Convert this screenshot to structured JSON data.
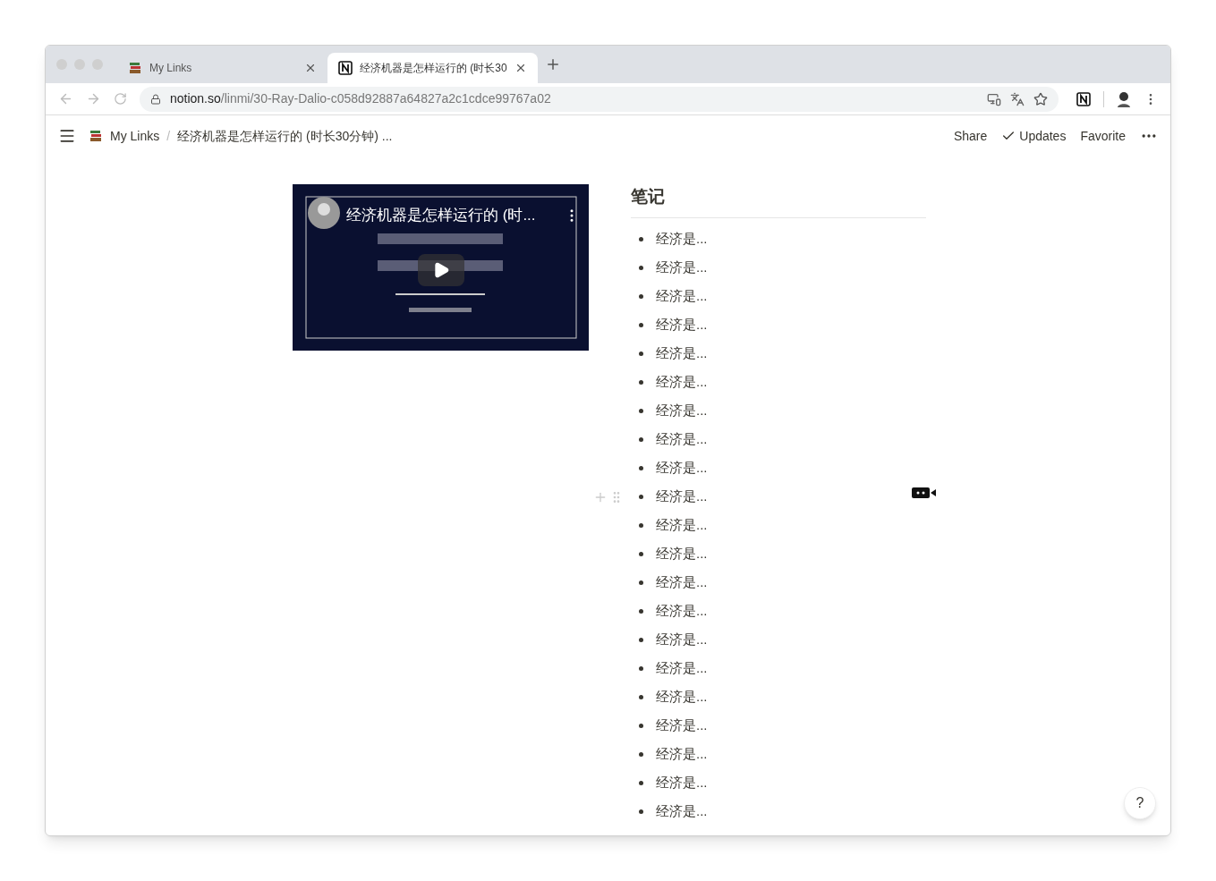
{
  "browser": {
    "tabs": [
      {
        "title": "My Links",
        "selected": false
      },
      {
        "title": "经济机器是怎样运行的 (时长30",
        "selected": true
      }
    ],
    "url": {
      "host": "notion.so",
      "path": "/linmi/30-Ray-Dalio-c058d92887a64827a2c1cdce99767a02"
    }
  },
  "topbar": {
    "separator": "/",
    "breadcrumbs": [
      "My Links",
      "经济机器是怎样运行的 (时长30分钟) ..."
    ],
    "actions": [
      "Share",
      "Updates",
      "Favorite"
    ]
  },
  "video": {
    "title": "经济机器是怎样运行的 (时..."
  },
  "notes": {
    "heading": "笔记",
    "items": [
      {
        "text": "经济是...",
        "hovered": false
      },
      {
        "text": "经济是...",
        "hovered": false
      },
      {
        "text": "经济是...",
        "hovered": false
      },
      {
        "text": "经济是...",
        "hovered": false
      },
      {
        "text": "经济是...",
        "hovered": false
      },
      {
        "text": "经济是...",
        "hovered": false
      },
      {
        "text": "经济是...",
        "hovered": false
      },
      {
        "text": "经济是...",
        "hovered": false
      },
      {
        "text": "经济是...",
        "hovered": false
      },
      {
        "text": "经济是...",
        "hovered": true
      },
      {
        "text": "经济是...",
        "hovered": false
      },
      {
        "text": "经济是...",
        "hovered": false
      },
      {
        "text": "经济是...",
        "hovered": false
      },
      {
        "text": "经济是...",
        "hovered": false
      },
      {
        "text": "经济是...",
        "hovered": false
      },
      {
        "text": "经济是...",
        "hovered": false
      },
      {
        "text": "经济是...",
        "hovered": false
      },
      {
        "text": "经济是...",
        "hovered": false
      },
      {
        "text": "经济是...",
        "hovered": false
      },
      {
        "text": "经济是...",
        "hovered": false
      },
      {
        "text": "经济是...",
        "hovered": false
      }
    ]
  },
  "help": "?"
}
